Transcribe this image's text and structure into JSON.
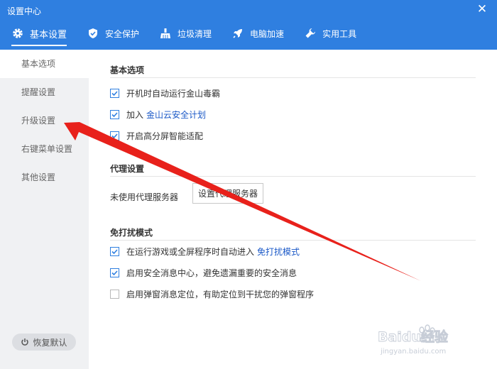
{
  "window": {
    "title": "设置中心"
  },
  "tabs": [
    {
      "label": "基本设置",
      "icon": "gear-icon",
      "active": true
    },
    {
      "label": "安全保护",
      "icon": "shield-icon"
    },
    {
      "label": "垃圾清理",
      "icon": "broom-icon"
    },
    {
      "label": "电脑加速",
      "icon": "rocket-icon"
    },
    {
      "label": "实用工具",
      "icon": "wrench-icon"
    }
  ],
  "sidebar": {
    "items": [
      {
        "label": "基本选项",
        "active": true
      },
      {
        "label": "提醒设置"
      },
      {
        "label": "升级设置"
      },
      {
        "label": "右键菜单设置"
      },
      {
        "label": "其他设置"
      }
    ],
    "restore_label": "恢复默认"
  },
  "basic": {
    "title": "基本选项",
    "options": [
      {
        "text": "开机时自动运行金山毒霸",
        "checked": true
      },
      {
        "text": "加入",
        "link": "金山云安全计划",
        "checked": true
      },
      {
        "text": "开启高分屏智能适配",
        "checked": true
      }
    ]
  },
  "proxy": {
    "title": "代理设置",
    "status": "未使用代理服务器",
    "button": "设置代理服务器"
  },
  "dnd": {
    "title": "免打扰模式",
    "options": [
      {
        "text": "在运行游戏或全屏程序时自动进入",
        "link": "免打扰模式",
        "checked": true
      },
      {
        "text": "启用安全消息中心，避免遗漏重要的安全消息",
        "checked": true
      },
      {
        "text": "启用弹窗消息定位，有助定位到干扰您的弹窗程序",
        "checked": false
      }
    ]
  },
  "watermark": {
    "text": "Baidu经验",
    "sub": "jingyan.baidu.com"
  },
  "colors": {
    "header": "#2f7fe0",
    "link": "#1a58c7",
    "arrow": "#e8211b",
    "sidebar": "#f0f1f3"
  }
}
